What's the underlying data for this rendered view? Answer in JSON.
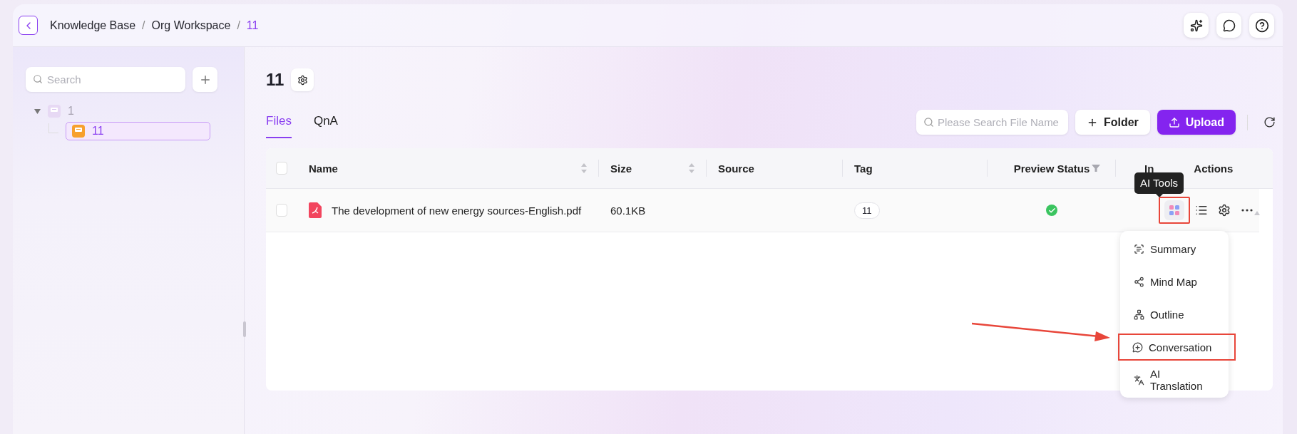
{
  "breadcrumb": [
    {
      "label": "Knowledge Base",
      "current": false
    },
    {
      "separator": "/",
      "label": "Org Workspace",
      "current": false
    },
    {
      "separator": "/",
      "label": "11",
      "current": true
    }
  ],
  "sidebar": {
    "search": {
      "placeholder": "Search"
    },
    "tree": [
      {
        "label": "1",
        "expanded": true,
        "children": [
          {
            "label": "11",
            "selected": true
          }
        ]
      }
    ]
  },
  "page": {
    "title": "11"
  },
  "tabs": [
    {
      "label": "Files",
      "selected": true
    },
    {
      "label": "QnA",
      "selected": false
    }
  ],
  "toolbar": {
    "search": {
      "placeholder": "Please Search File Name"
    },
    "buttons": [
      {
        "label": "Folder",
        "kind": "secondary"
      },
      {
        "label": "Upload",
        "kind": "primary"
      }
    ]
  },
  "table": {
    "all_checked": false,
    "columns": [
      {
        "label": "Name",
        "kind": "sort"
      },
      {
        "label": "Size",
        "kind": "sort"
      },
      {
        "label": "Source",
        "kind": "plain"
      },
      {
        "label": "Tag",
        "kind": "plain"
      },
      {
        "label": "Preview Status",
        "kind": "filter"
      },
      {
        "label": "In",
        "label_2": "Actions",
        "kind": "split"
      }
    ],
    "rows": [
      {
        "checked": false,
        "name": "The development of new energy sources-English.pdf",
        "size": "60.1KB",
        "tag": "11",
        "preview_ready": true,
        "actions": [
          {
            "kind": "ai-tools",
            "highlighted": true,
            "tooltip": "AI Tools"
          },
          {
            "kind": "list",
            "highlighted": false
          },
          {
            "kind": "settings",
            "highlighted": false
          },
          {
            "kind": "more",
            "highlighted": false
          }
        ]
      }
    ]
  },
  "action_menu": [
    {
      "label": "Summary",
      "kind": "summary",
      "highlighted": false
    },
    {
      "label": "Mind Map",
      "kind": "mindmap",
      "highlighted": false
    },
    {
      "label": "Outline",
      "kind": "outline",
      "highlighted": false
    },
    {
      "label": "Conversation",
      "kind": "conversation",
      "highlighted": true
    },
    {
      "label": "AI Translation",
      "kind": "translation",
      "highlighted": false
    }
  ]
}
